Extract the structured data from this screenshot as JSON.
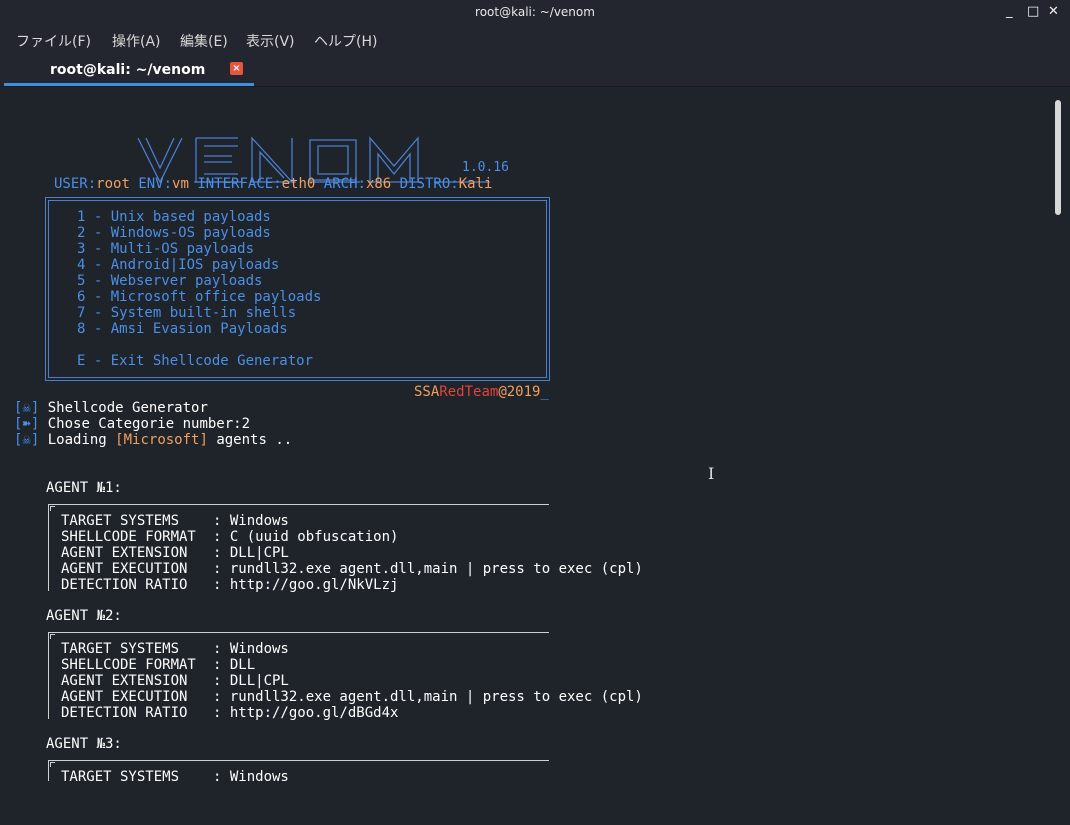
{
  "window": {
    "title": "root@kali: ~/venom",
    "buttons": [
      "_",
      "□",
      "✕"
    ]
  },
  "menubar": [
    "ファイル(F)",
    "操作(A)",
    "編集(E)",
    "表示(V)",
    "ヘルプ(H)"
  ],
  "tab": {
    "label": "root@kali: ~/venom",
    "close": "×"
  },
  "banner": {
    "art": "VENOM",
    "version": "1.0.16"
  },
  "env": {
    "user_k": "USER:",
    "user_v": "root",
    "env_k": "ENV:",
    "env_v": "vm",
    "iface_k": "INTERFACE:",
    "iface_v": "eth0",
    "arch_k": "ARCH:",
    "arch_v": "x86",
    "distro_k": "DISTRO:",
    "distro_v": "Kali"
  },
  "menu": [
    "1 - Unix based payloads",
    "2 - Windows-OS payloads",
    "3 - Multi-OS payloads",
    "4 - Android|IOS payloads",
    "5 - Webserver payloads",
    "6 - Microsoft office payloads",
    "7 - System built-in shells",
    "8 - Amsi Evasion Payloads",
    "E - Exit Shellcode Generator"
  ],
  "credit": {
    "a": "SSA",
    "b": "RedTeam",
    "c": "@2019",
    "d": "_"
  },
  "log": [
    {
      "prefix": "[☠]",
      "text": "Shellcode Generator"
    },
    {
      "prefix": "[➽]",
      "text": "Chose Categorie number:2"
    },
    {
      "prefix": "[☠]",
      "text": "Loading ",
      "hl": "[Microsoft]",
      "rest": " agents .."
    }
  ],
  "agents": [
    {
      "title": "AGENT №1:",
      "fields": [
        {
          "k": "TARGET SYSTEMS",
          "v": ": Windows"
        },
        {
          "k": "SHELLCODE FORMAT",
          "v": ": C (uuid obfuscation)"
        },
        {
          "k": "AGENT EXTENSION",
          "v": ": DLL|CPL"
        },
        {
          "k": "AGENT EXECUTION",
          "v": ": rundll32.exe agent.dll,main | press to exec (cpl)"
        },
        {
          "k": "DETECTION RATIO",
          "v": ": http://goo.gl/NkVLzj"
        }
      ]
    },
    {
      "title": "AGENT №2:",
      "fields": [
        {
          "k": "TARGET SYSTEMS",
          "v": ": Windows"
        },
        {
          "k": "SHELLCODE FORMAT",
          "v": ": DLL"
        },
        {
          "k": "AGENT EXTENSION",
          "v": ": DLL|CPL"
        },
        {
          "k": "AGENT EXECUTION",
          "v": ": rundll32.exe agent.dll,main | press to exec (cpl)"
        },
        {
          "k": "DETECTION RATIO",
          "v": ": http://goo.gl/dBGd4x"
        }
      ]
    },
    {
      "title": "AGENT №3:",
      "fields": [
        {
          "k": "TARGET SYSTEMS",
          "v": ": Windows"
        }
      ]
    }
  ]
}
